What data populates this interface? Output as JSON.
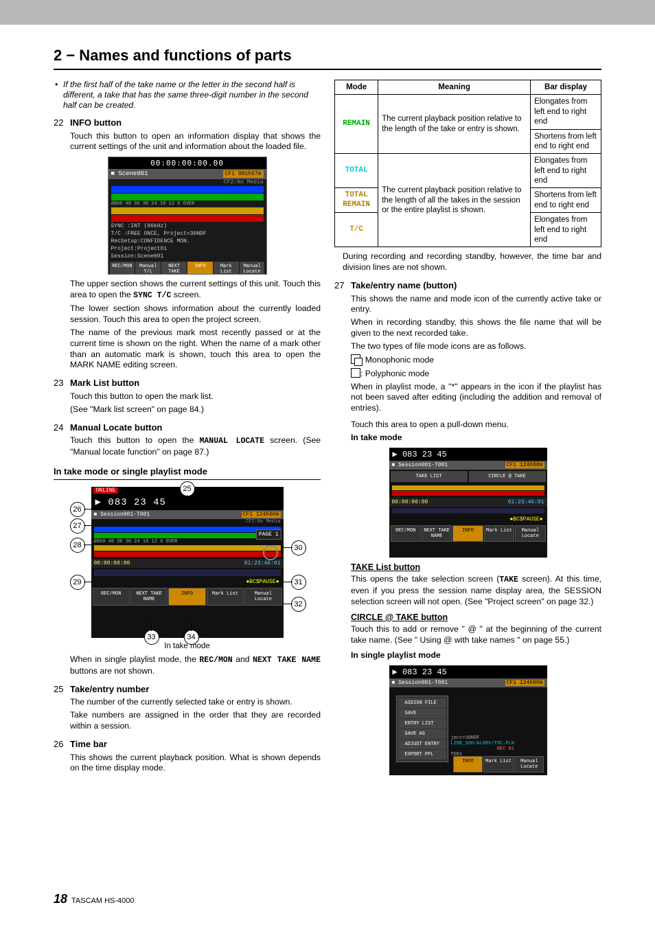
{
  "chapter_title": "2 − Names and functions of parts",
  "left": {
    "note": "If the first half of the take name or the letter in the second half is different, a take that has the same three-digit number in the second half can be created.",
    "s22": {
      "num": "22",
      "title": "INFO button",
      "p1": "Touch this button to open an information display that shows the current settings of the unit and information about the loaded file.",
      "p2a": "The upper section shows the current settings of this unit. Touch this area to open the ",
      "p2b": " screen.",
      "mono1": "SYNC T/C",
      "p3": "The lower section shows information about the currently loaded session. Touch this area to open the project screen.",
      "p4": "The name of the previous mark most recently passed or at the current time is shown on the right. When the name of a mark other than an automatic mark is shown, touch this area to open the MARK NAME editing screen."
    },
    "fig1": {
      "tc": "00:00:00:00.00",
      "session": "Scene001",
      "media": "CF1 001h57m",
      "sub": "CF2:No Media",
      "r1": "SYNC  :INT (96kHz)",
      "r2": "T/C   :FREE ONCE, Project=30NDF",
      "r3": "RecSetup:CONFIDENCE MON.",
      "r4": "Project:Project01",
      "r5": "Session:Scene001",
      "b1": "REC/MON",
      "b2": "Manual T/L",
      "b3": "NEXT TAKE",
      "b4": "INFO",
      "b5": "Mark List",
      "b6": "Manual Locate"
    },
    "s23": {
      "num": "23",
      "title": "Mark List button",
      "p1": "Touch this button to open the mark list.",
      "p2": "(See \"Mark list screen\" on page 84.)"
    },
    "s24": {
      "num": "24",
      "title": "Manual Locate button",
      "p1a": "Touch this button to open the ",
      "mono": "MANUAL LOCATE",
      "p1b": " screen. (See \"Manual locate function\" on page 87.)"
    },
    "sub_heading": "In take mode or single playlist mode",
    "annot": {
      "online": "ONLINE",
      "tc": "083  23 45 ",
      "session": "Session001-T001",
      "media": "CF1 124h00m",
      "mediasub": "CF2:No Media",
      "page": "PAGE 1",
      "t_left": "00:00:00:00",
      "t_right": "01:23:46:01",
      "bcs": "BC$PAUSE",
      "b1": "REC/MON",
      "b2": "NEXT TAKE NAME",
      "b3": "INFO",
      "b4": "Mark List",
      "b5": "Manual Locate",
      "caption": "In take mode",
      "c25": "25",
      "c26": "26",
      "c27": "27",
      "c28": "28",
      "c29": "29",
      "c30": "30",
      "c31": "31",
      "c32": "32",
      "c33": "33",
      "c34": "34"
    },
    "after_fig_a": "When in single playlist mode, the ",
    "after_fig_m1": "REC/MON",
    "after_fig_b": " and ",
    "after_fig_m2": "NEXT TAKE NAME",
    "after_fig_c": " buttons are not shown.",
    "s25": {
      "num": "25",
      "title": "Take/entry number",
      "p1": "The number of the currently selected take or entry is shown.",
      "p2": "Take numbers are assigned in the order that they are recorded within a session."
    },
    "s26": {
      "num": "26",
      "title": "Time bar",
      "p1": "This shows the current playback position. What is shown depends on the time display mode."
    }
  },
  "right": {
    "table": {
      "h1": "Mode",
      "h2": "Meaning",
      "h3": "Bar display",
      "m_remain": "REMAIN",
      "meaning1": "The current playback position relative to the length of the take or entry is shown.",
      "bar1": "Elongates from left end to right end",
      "bar2": "Shortens from left end to right end",
      "m_total": "TOTAL",
      "m_totalremain": "TOTAL REMAIN",
      "meaning2": "The current playback position relative to the length of all the takes in the session or the entire playlist is shown.",
      "bar3": "Elongates from left end to right end",
      "bar4": "Shortens from left end to right end",
      "m_tc": "T/C",
      "bar5": "Elongates from left end to right end"
    },
    "table_note": "During recording and recording standby, however, the time bar and division lines are not shown.",
    "s27": {
      "num": "27",
      "title": "Take/entry name (button)",
      "p1": "This shows the name and mode icon of the currently active take or entry.",
      "p2": "When in recording standby, this shows the file name that will be given to the next recorded take.",
      "p3": "The two types of file mode icons are as follows.",
      "mono_label": ": Monophonic mode",
      "poly_label": ": Polyphonic mode",
      "p4": "When in playlist mode, a \"*\" appears in the icon if the playlist has not been saved after editing (including the addition and removal of entries).",
      "p5": "Touch this area to open a pull-down menu."
    },
    "take_mode_heading": "In take mode",
    "fig_take": {
      "tc": "083  23 45 ",
      "session": "Session001-T001",
      "media": "CF1 124h00m",
      "b_take": "TAKE LIST",
      "b_circle": "CIRCLE @ TAKE",
      "t_left": "00:00:00:00",
      "t_right": "01:23:46:01",
      "bcs": "BC$PAUSE",
      "b1": "REC/MON",
      "b2": "NEXT TAKE NAME",
      "b3": "INFO",
      "b4": "Mark List",
      "b5": "Manual Locate"
    },
    "take_list": {
      "title": "TAKE List button",
      "p1a": "This opens the take selection screen (",
      "mono": "TAKE",
      "p1b": " screen). At this time, even if you press the session name display area, the SESSION selection screen will not open. (See \"Project screen\" on page 32.)"
    },
    "circle": {
      "title": "CIRCLE @ TAKE button",
      "p1": "Touch this to add or remove \" @ \" at the beginning of the current take name. (See \" Using @ with take names \" on page 55.)"
    },
    "single_heading": "In single playlist mode",
    "fig_single": {
      "tc": "083  23 45 ",
      "session": "Session001-T001",
      "media": "CF1 124h00m",
      "m1": "ASSIGN FILE",
      "m2": "SAVE",
      "m3": "ENTRY LIST",
      "m4": "SAVE AS",
      "m5": "ADJUST ENTRY",
      "m6": "EXPORT PPL",
      "overlay": "ject=30NDF",
      "overlay2": "LINE_S00/AL08V/TOC.PLN",
      "rec": "REC 01",
      "t001": "T001",
      "b3": "INFO",
      "b4": "Mark List",
      "b5": "Manual Locate"
    }
  },
  "footer": {
    "page": "18",
    "product": "TASCAM HS-4000"
  }
}
